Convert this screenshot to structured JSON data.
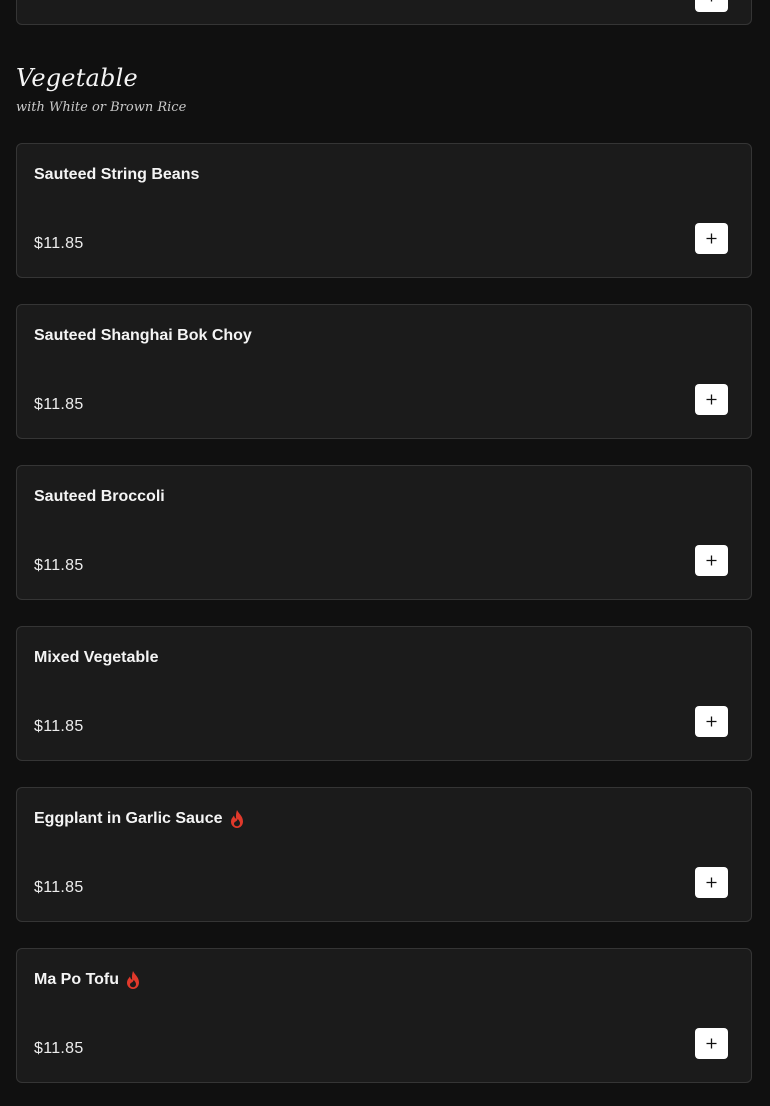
{
  "section": {
    "title": "Vegetable",
    "subtitle": "with White or Brown Rice"
  },
  "colors": {
    "background": "#101010",
    "card": "#1b1b1b",
    "card_border": "#353535",
    "spicy": "#e0392b",
    "button": "#ffffff"
  },
  "items": [
    {
      "name": "Sauteed String Beans",
      "price": "$11.85",
      "spicy": false
    },
    {
      "name": "Sauteed Shanghai Bok Choy",
      "price": "$11.85",
      "spicy": false
    },
    {
      "name": "Sauteed Broccoli",
      "price": "$11.85",
      "spicy": false
    },
    {
      "name": "Mixed Vegetable",
      "price": "$11.85",
      "spicy": false
    },
    {
      "name": "Eggplant in Garlic Sauce",
      "price": "$11.85",
      "spicy": true
    },
    {
      "name": "Ma Po Tofu",
      "price": "$11.85",
      "spicy": true
    }
  ],
  "icons": {
    "add": "plus-icon",
    "spicy": "flame-icon"
  }
}
